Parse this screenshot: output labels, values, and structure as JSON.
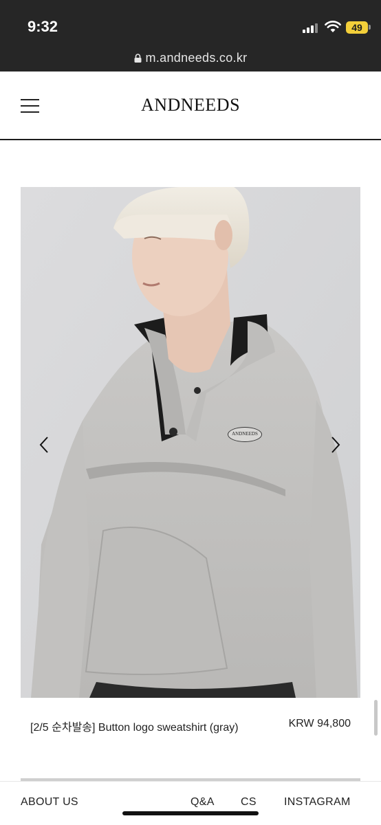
{
  "status_bar": {
    "time": "9:32",
    "battery_level": "49",
    "signal_icon": "cellular-signal-icon",
    "wifi_icon": "wifi-icon",
    "battery_color": "#f3cf3a"
  },
  "browser": {
    "url": "m.andneeds.co.kr",
    "lock_icon": "lock-icon"
  },
  "header": {
    "menu_icon": "hamburger-menu-icon",
    "brand": "ANDNEEDS"
  },
  "product": {
    "image_description_icon": "product-photo",
    "prev_icon": "chevron-left-icon",
    "next_icon": "chevron-right-icon",
    "logo_patch_text": "ANDNEEDS",
    "name": "[2/5 순차발송] Button logo sweatshirt (gray)",
    "price": "KRW 94,800"
  },
  "footer": {
    "links": [
      "ABOUT US",
      "Q&A",
      "CS",
      "INSTAGRAM"
    ]
  }
}
